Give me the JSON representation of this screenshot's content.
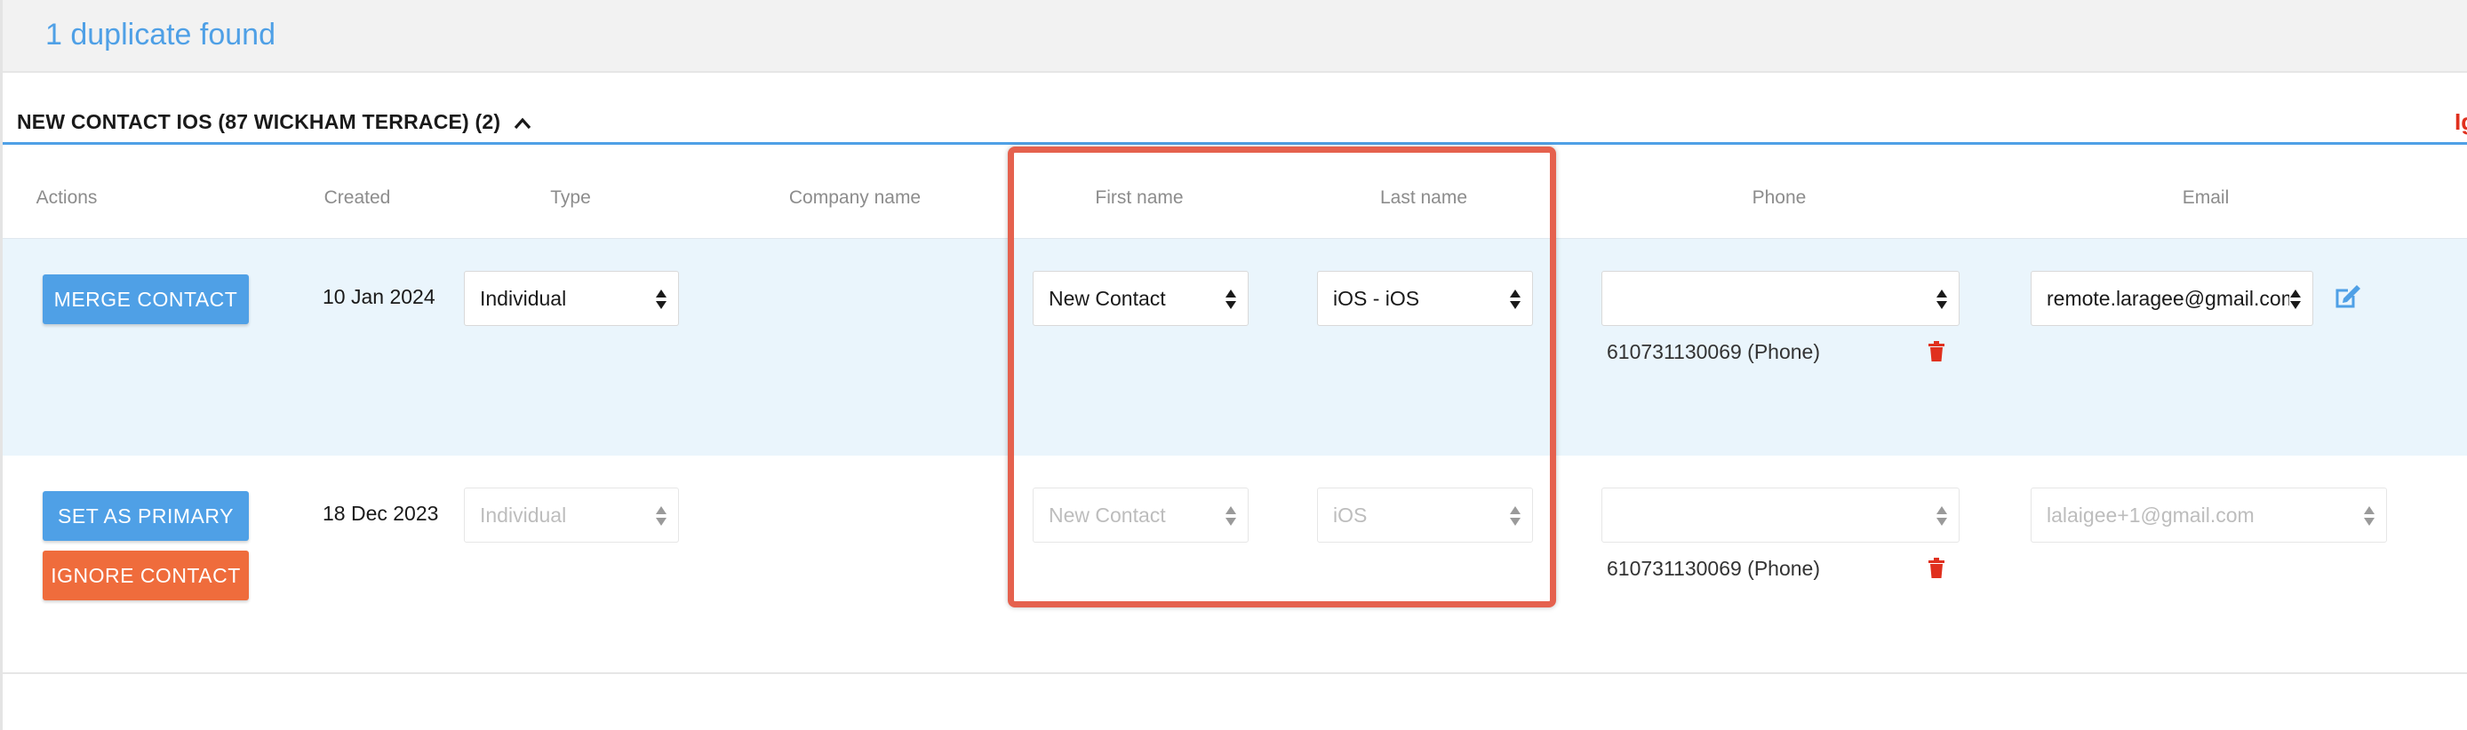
{
  "banner": {
    "text": "1 duplicate found"
  },
  "group": {
    "title": "NEW CONTACT IOS (87 WICKHAM TERRACE) (2)",
    "ignore_partial": "Ig"
  },
  "columns": {
    "actions": "Actions",
    "created": "Created",
    "type": "Type",
    "company": "Company name",
    "first_name": "First name",
    "last_name": "Last name",
    "phone": "Phone",
    "email": "Email"
  },
  "rows": [
    {
      "merge_label": "MERGE CONTACT",
      "created": "10 Jan 2024",
      "type": "Individual",
      "first_name": "New Contact",
      "last_name": "iOS - iOS",
      "phone_select": "",
      "phone_text": "610731130069 (Phone)",
      "email": "remote.laragee@gmail.com"
    },
    {
      "primary_label": "SET AS PRIMARY",
      "ignore_label": "IGNORE CONTACT",
      "created": "18 Dec 2023",
      "type": "Individual",
      "first_name": "New Contact",
      "last_name": "iOS",
      "phone_select": "",
      "phone_text": "610731130069 (Phone)",
      "email": "lalaigee+1@gmail.com"
    }
  ],
  "colors": {
    "accent": "#4fa0e6",
    "danger": "#e0301e",
    "ignore_button": "#ef6c3c",
    "highlight": "#e5614e",
    "primary_row_bg": "#eaf5fc"
  }
}
